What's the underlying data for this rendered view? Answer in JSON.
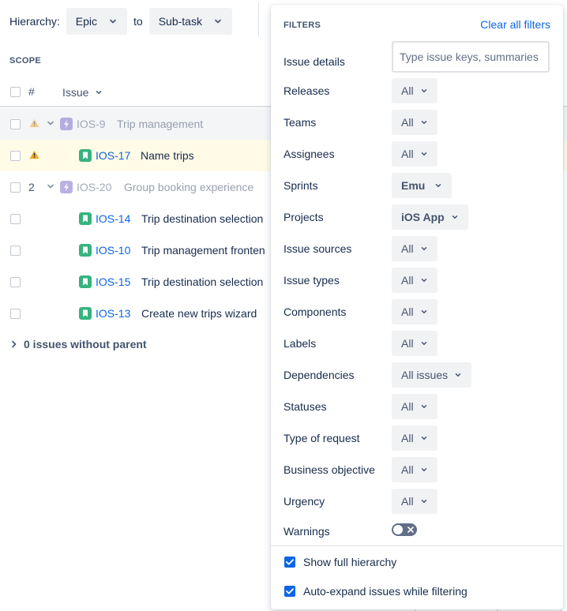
{
  "hierarchy": {
    "label": "Hierarchy:",
    "from": "Epic",
    "to_label": "to",
    "to": "Sub-task"
  },
  "scope": {
    "title": "SCOPE",
    "columns": {
      "hash": "#",
      "issue": "Issue"
    },
    "rows": [
      {
        "num": "",
        "warning": true,
        "expandable": true,
        "type": "epic",
        "key": "IOS-9",
        "title": "Trip management",
        "faded": true
      },
      {
        "num": "",
        "warning": true,
        "expandable": false,
        "type": "story",
        "key": "IOS-17",
        "title": "Name trips",
        "faded": false,
        "highlight": true
      },
      {
        "num": "2",
        "warning": false,
        "expandable": true,
        "type": "epic",
        "key": "IOS-20",
        "title": "Group booking experience",
        "faded": true
      },
      {
        "num": "",
        "warning": false,
        "expandable": false,
        "type": "story",
        "key": "IOS-14",
        "title": "Trip destination selection",
        "faded": false
      },
      {
        "num": "",
        "warning": false,
        "expandable": false,
        "type": "story",
        "key": "IOS-10",
        "title": "Trip management fronten",
        "faded": false
      },
      {
        "num": "",
        "warning": false,
        "expandable": false,
        "type": "story",
        "key": "IOS-15",
        "title": "Trip destination selection",
        "faded": false
      },
      {
        "num": "",
        "warning": false,
        "expandable": false,
        "type": "story",
        "key": "IOS-13",
        "title": "Create new trips wizard",
        "faded": false
      }
    ],
    "no_parent": "0 issues without parent"
  },
  "filters": {
    "heading": "FILTERS",
    "clear_all": "Clear all filters",
    "issue_details": {
      "label": "Issue details",
      "placeholder": "Type issue keys, summaries"
    },
    "items": [
      {
        "label": "Releases",
        "value": "All"
      },
      {
        "label": "Teams",
        "value": "All"
      },
      {
        "label": "Assignees",
        "value": "All"
      },
      {
        "label": "Sprints",
        "value": "Emu"
      },
      {
        "label": "Projects",
        "value": "iOS App"
      },
      {
        "label": "Issue sources",
        "value": "All"
      },
      {
        "label": "Issue types",
        "value": "All"
      },
      {
        "label": "Components",
        "value": "All"
      },
      {
        "label": "Labels",
        "value": "All"
      },
      {
        "label": "Dependencies",
        "value": "All issues"
      },
      {
        "label": "Statuses",
        "value": "All"
      },
      {
        "label": "Type of request",
        "value": "All"
      },
      {
        "label": "Business objective",
        "value": "All"
      },
      {
        "label": "Urgency",
        "value": "All"
      }
    ],
    "warnings": {
      "label": "Warnings",
      "enabled": false
    },
    "show_full_hierarchy": {
      "label": "Show full hierarchy",
      "checked": true
    },
    "auto_expand": {
      "label": "Auto-expand issues while filtering",
      "checked": true
    }
  },
  "colors": {
    "link": "#0c66e4",
    "story_icon": "#36b37e",
    "epic_icon": "#6554c0",
    "warning": "#f5a623",
    "highlight_row": "#fffbe6"
  }
}
